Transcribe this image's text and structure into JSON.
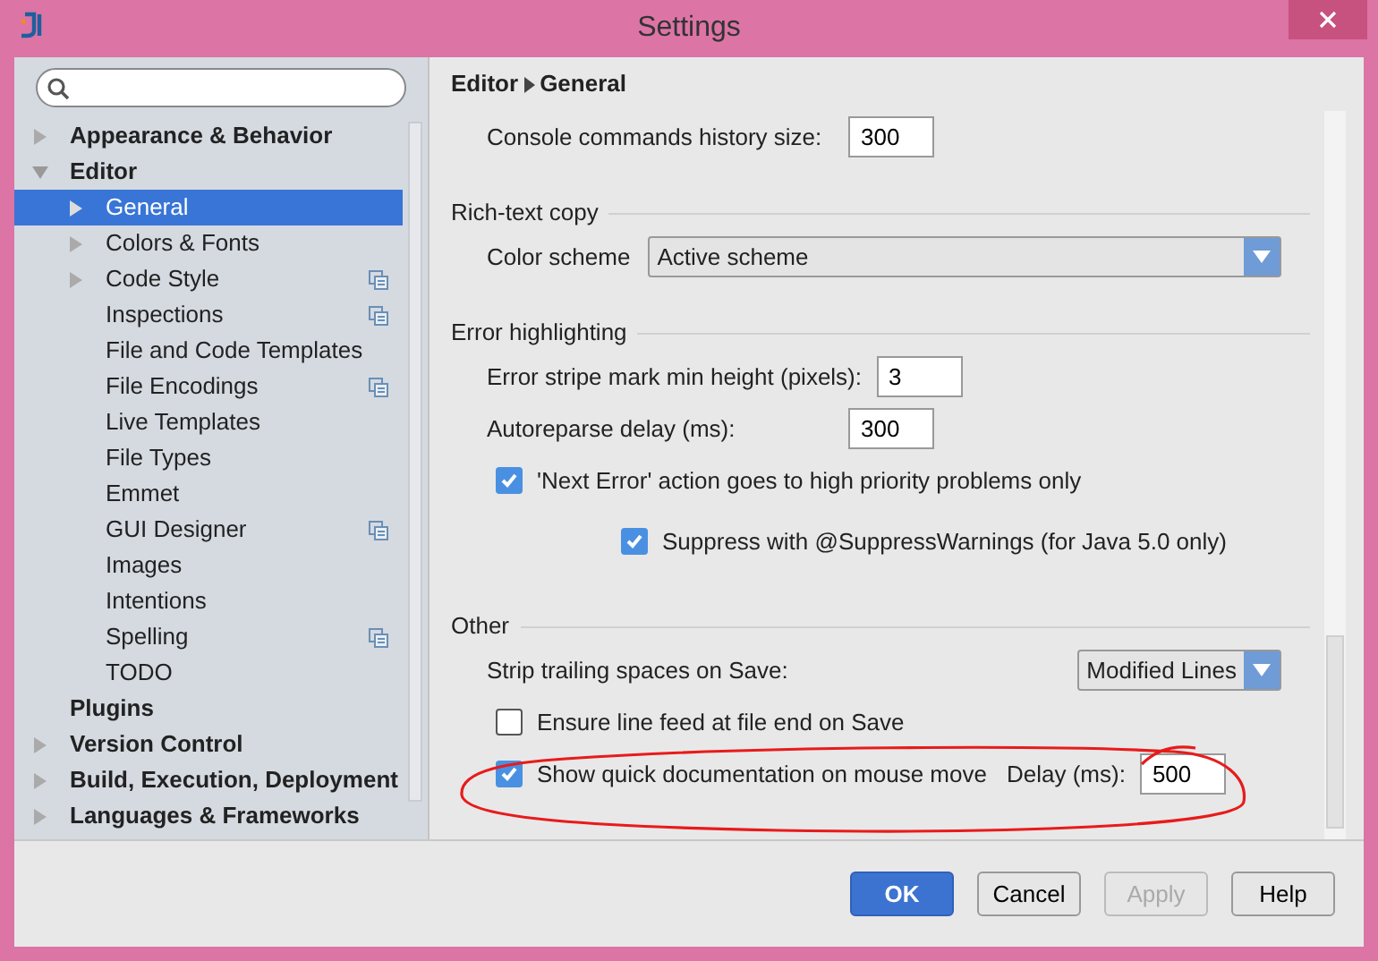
{
  "window": {
    "title": "Settings"
  },
  "sidebar": {
    "items": [
      {
        "label": "Appearance & Behavior",
        "expanded": false,
        "selected": false,
        "project_icon": false
      },
      {
        "label": "Editor",
        "expanded": true,
        "selected": false,
        "project_icon": false,
        "children": [
          {
            "label": "General",
            "expanded": false,
            "selected": true,
            "project_icon": false
          },
          {
            "label": "Colors & Fonts",
            "expanded": false,
            "selected": false,
            "project_icon": false
          },
          {
            "label": "Code Style",
            "expanded": false,
            "selected": false,
            "project_icon": true
          },
          {
            "label": "Inspections",
            "selected": false,
            "project_icon": true
          },
          {
            "label": "File and Code Templates",
            "selected": false,
            "project_icon": false
          },
          {
            "label": "File Encodings",
            "selected": false,
            "project_icon": true
          },
          {
            "label": "Live Templates",
            "selected": false,
            "project_icon": false
          },
          {
            "label": "File Types",
            "selected": false,
            "project_icon": false
          },
          {
            "label": "Emmet",
            "selected": false,
            "project_icon": false
          },
          {
            "label": "GUI Designer",
            "selected": false,
            "project_icon": true
          },
          {
            "label": "Images",
            "selected": false,
            "project_icon": false
          },
          {
            "label": "Intentions",
            "selected": false,
            "project_icon": false
          },
          {
            "label": "Spelling",
            "selected": false,
            "project_icon": true
          },
          {
            "label": "TODO",
            "selected": false,
            "project_icon": false
          }
        ]
      },
      {
        "label": "Plugins",
        "selected": false,
        "project_icon": false
      },
      {
        "label": "Version Control",
        "expanded": false,
        "selected": false,
        "project_icon": false
      },
      {
        "label": "Build, Execution, Deployment",
        "expanded": false,
        "selected": false,
        "project_icon": false
      },
      {
        "label": "Languages & Frameworks",
        "expanded": false,
        "selected": false,
        "project_icon": false
      }
    ]
  },
  "breadcrumb": [
    "Editor",
    "General"
  ],
  "sections": [
    {
      "items": [
        {
          "kind": "field",
          "label": "Console commands history size:",
          "value": "300"
        }
      ]
    },
    {
      "title": "Rich-text copy",
      "items": [
        {
          "kind": "dropdown",
          "label": "Color scheme",
          "value": "Active scheme",
          "wide": true
        }
      ]
    },
    {
      "title": "Error highlighting",
      "items": [
        {
          "kind": "field",
          "label": "Error stripe mark min height (pixels):",
          "value": "3"
        },
        {
          "kind": "field",
          "label": "Autoreparse delay (ms):",
          "value": "300"
        },
        {
          "kind": "checkbox",
          "label": "'Next Error' action goes to high priority problems only",
          "checked": true,
          "children": [
            {
              "kind": "checkbox",
              "label": "Suppress with @SuppressWarnings (for Java 5.0 only)",
              "checked": true
            }
          ]
        }
      ]
    },
    {
      "title": "Other",
      "items": [
        {
          "kind": "dropdown",
          "label": "Strip trailing spaces on Save:",
          "value": "Modified Lines",
          "wide": false
        },
        {
          "kind": "checkbox",
          "label": "Ensure line feed at file end on Save",
          "checked": false
        },
        {
          "kind": "checkbox",
          "label": "Show quick documentation on mouse move",
          "checked": true,
          "field": {
            "label": "Delay (ms):",
            "value": "500"
          }
        }
      ]
    }
  ],
  "buttons": [
    {
      "label": "OK",
      "kind": "primary",
      "disabled": false
    },
    {
      "label": "Cancel",
      "kind": "normal",
      "disabled": false
    },
    {
      "label": "Apply",
      "kind": "normal",
      "disabled": true
    },
    {
      "label": "Help",
      "kind": "normal",
      "disabled": false
    }
  ]
}
